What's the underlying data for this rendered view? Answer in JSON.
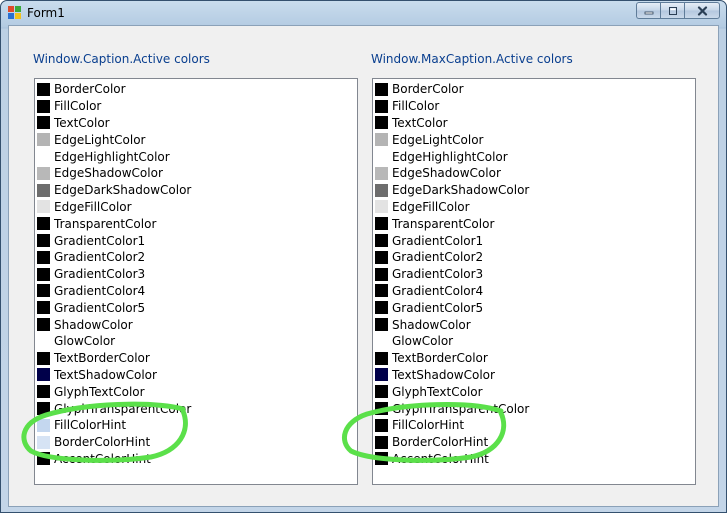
{
  "window": {
    "title": "Form1"
  },
  "colors": {
    "black": "#000000",
    "white": "#ffffff",
    "edge_light": "#b4b4b4",
    "edge_shadow": "#b8b8b8",
    "edge_dark_shadow": "#6d6d6d",
    "edge_fill": "#e3e3e3",
    "navy": "#00004a",
    "hint_blue": "#c4d7ef",
    "hint_blue_light": "#d6e3f4",
    "highlight_green": "#5be04a",
    "group_title": "#0a3f8f"
  },
  "panels": [
    {
      "title": "Window.Caption.Active colors",
      "items": [
        {
          "label": "BorderColor",
          "color": "#000000"
        },
        {
          "label": "FillColor",
          "color": "#000000"
        },
        {
          "label": "TextColor",
          "color": "#000000"
        },
        {
          "label": "EdgeLightColor",
          "color": "#b4b4b4"
        },
        {
          "label": "EdgeHighlightColor",
          "color": "#ffffff"
        },
        {
          "label": "EdgeShadowColor",
          "color": "#b8b8b8"
        },
        {
          "label": "EdgeDarkShadowColor",
          "color": "#6d6d6d"
        },
        {
          "label": "EdgeFillColor",
          "color": "#e3e3e3"
        },
        {
          "label": "TransparentColor",
          "color": "#000000"
        },
        {
          "label": "GradientColor1",
          "color": "#000000"
        },
        {
          "label": "GradientColor2",
          "color": "#000000"
        },
        {
          "label": "GradientColor3",
          "color": "#000000"
        },
        {
          "label": "GradientColor4",
          "color": "#000000"
        },
        {
          "label": "GradientColor5",
          "color": "#000000"
        },
        {
          "label": "ShadowColor",
          "color": "#000000"
        },
        {
          "label": "GlowColor",
          "color": "#ffffff"
        },
        {
          "label": "TextBorderColor",
          "color": "#000000"
        },
        {
          "label": "TextShadowColor",
          "color": "#00004a"
        },
        {
          "label": "GlyphTextColor",
          "color": "#000000"
        },
        {
          "label": "GlyphTransparentColor",
          "color": "#000000"
        },
        {
          "label": "FillColorHint",
          "color": "#c4d7ef"
        },
        {
          "label": "BorderColorHint",
          "color": "#d6e3f4"
        },
        {
          "label": "AccentColorHint",
          "color": "#000000"
        }
      ]
    },
    {
      "title": "Window.MaxCaption.Active colors",
      "items": [
        {
          "label": "BorderColor",
          "color": "#000000"
        },
        {
          "label": "FillColor",
          "color": "#000000"
        },
        {
          "label": "TextColor",
          "color": "#000000"
        },
        {
          "label": "EdgeLightColor",
          "color": "#b4b4b4"
        },
        {
          "label": "EdgeHighlightColor",
          "color": "#ffffff"
        },
        {
          "label": "EdgeShadowColor",
          "color": "#b8b8b8"
        },
        {
          "label": "EdgeDarkShadowColor",
          "color": "#6d6d6d"
        },
        {
          "label": "EdgeFillColor",
          "color": "#e3e3e3"
        },
        {
          "label": "TransparentColor",
          "color": "#000000"
        },
        {
          "label": "GradientColor1",
          "color": "#000000"
        },
        {
          "label": "GradientColor2",
          "color": "#000000"
        },
        {
          "label": "GradientColor3",
          "color": "#000000"
        },
        {
          "label": "GradientColor4",
          "color": "#000000"
        },
        {
          "label": "GradientColor5",
          "color": "#000000"
        },
        {
          "label": "ShadowColor",
          "color": "#000000"
        },
        {
          "label": "GlowColor",
          "color": "#ffffff"
        },
        {
          "label": "TextBorderColor",
          "color": "#000000"
        },
        {
          "label": "TextShadowColor",
          "color": "#00004a"
        },
        {
          "label": "GlyphTextColor",
          "color": "#000000"
        },
        {
          "label": "GlyphTransparentColor",
          "color": "#000000"
        },
        {
          "label": "FillColorHint",
          "color": "#000000"
        },
        {
          "label": "BorderColorHint",
          "color": "#000000"
        },
        {
          "label": "AccentColorHint",
          "color": "#000000"
        }
      ]
    }
  ],
  "icons": {
    "app": "form-icon",
    "minimize": "minimize-icon",
    "maximize": "maximize-icon",
    "close": "close-icon"
  }
}
